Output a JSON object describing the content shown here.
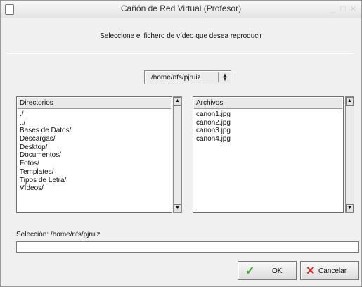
{
  "window": {
    "title": "Cañón de Red Virtual (Profesor)",
    "controls": "_ □ ×"
  },
  "prompt": "Seleccione el fichero de vídeo que desea reproducir",
  "path_select": {
    "value": "/home/nfs/pjruiz",
    "icon": "updown-arrows-icon"
  },
  "directories": {
    "header": "Directorios",
    "items": [
      "./",
      "../",
      "Bases de Datos/",
      "Descargas/",
      "Desktop/",
      "Documentos/",
      "Fotos/",
      "Templates/",
      "Tipos de Letra/",
      "Vídeos/"
    ]
  },
  "files": {
    "header": "Archivos",
    "items": [
      "canon1.jpg",
      "canon2.jpg",
      "canon3.jpg",
      "canon4.jpg"
    ]
  },
  "selection": {
    "label": "Selección: /home/nfs/pjruiz",
    "value": ""
  },
  "buttons": {
    "ok": "OK",
    "cancel": "Cancelar"
  },
  "colors": {
    "ok_icon": "#3cab2d",
    "cancel_icon": "#d1322b"
  }
}
